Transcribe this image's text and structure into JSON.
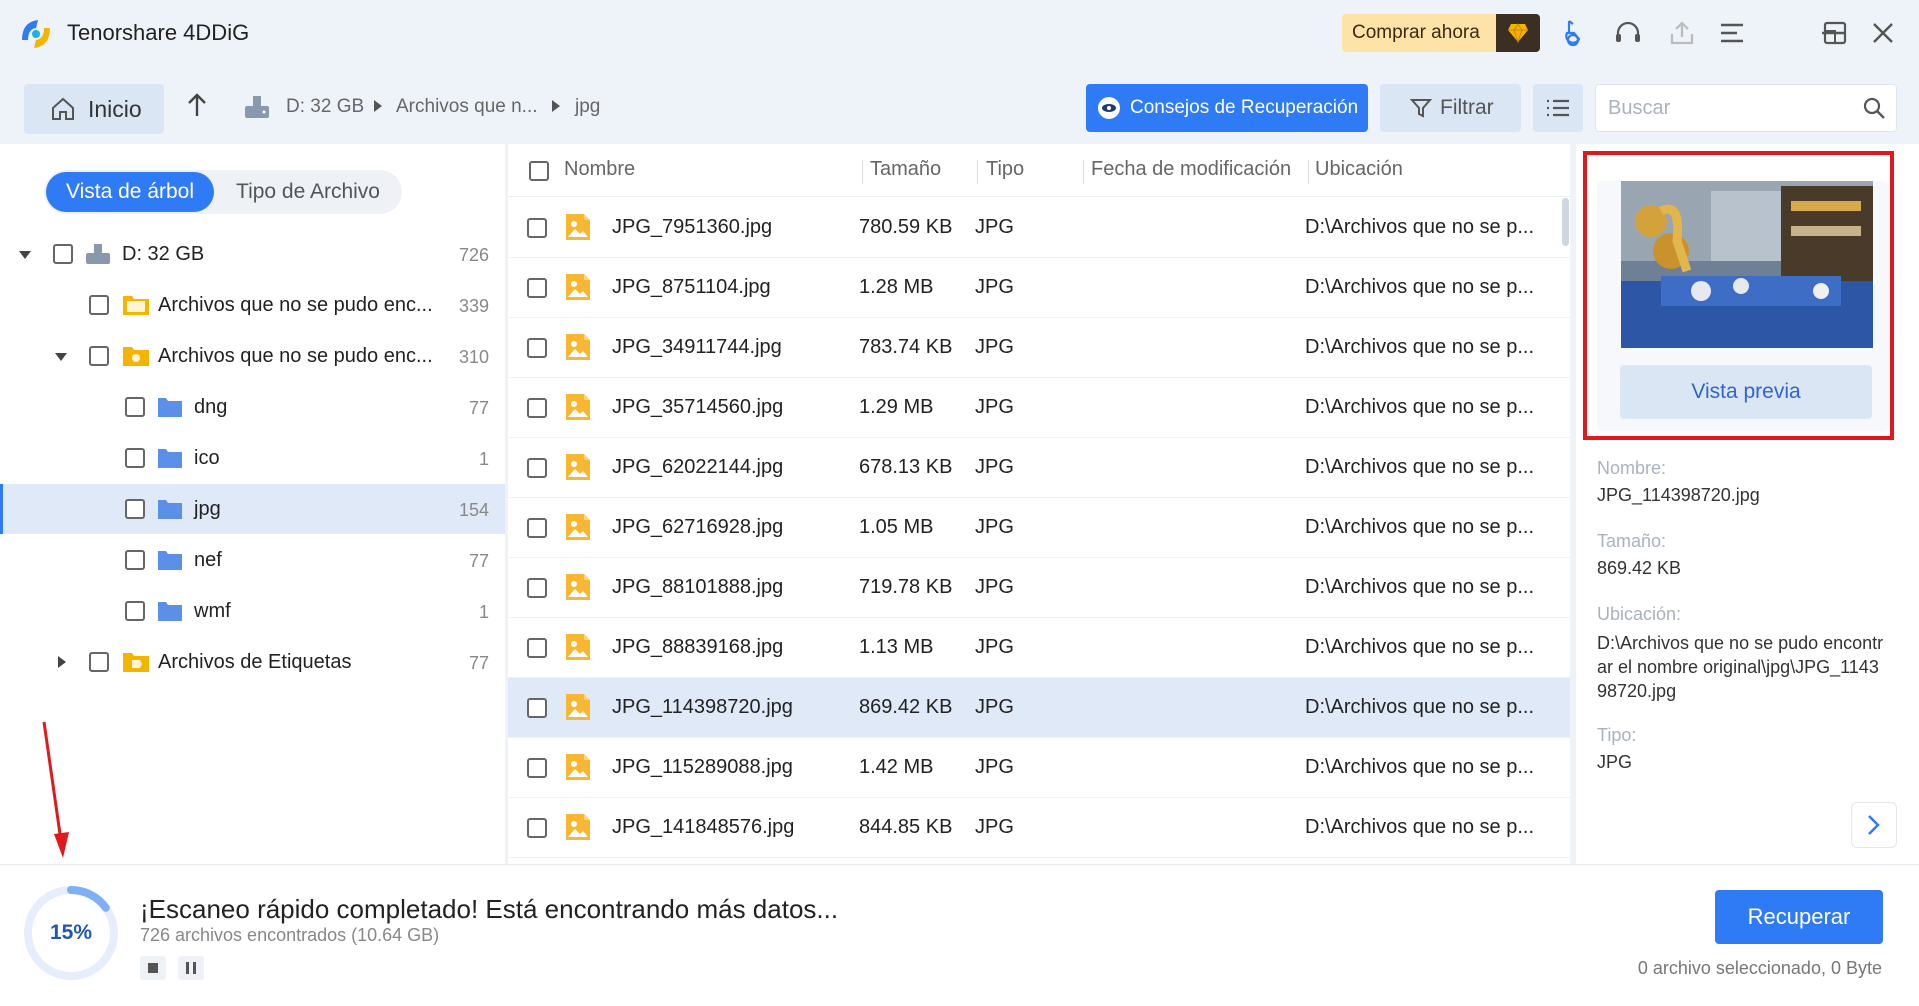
{
  "app": {
    "title": "Tenorshare 4DDiG",
    "buy_label": "Comprar ahora"
  },
  "nav": {
    "home_label": "Inicio",
    "breadcrumb": [
      "D: 32 GB",
      "Archivos que n...",
      "jpg"
    ],
    "tips_label": "Consejos de Recuperación",
    "filter_label": "Filtrar",
    "search_placeholder": "Buscar"
  },
  "tabs": {
    "tree_view": "Vista de árbol",
    "file_type": "Tipo de Archivo"
  },
  "tree": [
    {
      "label": "D: 32 GB",
      "count": "726"
    },
    {
      "label": "Archivos que no se pudo enc...",
      "count": "339"
    },
    {
      "label": "Archivos que no se pudo enc...",
      "count": "310"
    },
    {
      "label": "dng",
      "count": "77"
    },
    {
      "label": "ico",
      "count": "1"
    },
    {
      "label": "jpg",
      "count": "154"
    },
    {
      "label": "nef",
      "count": "77"
    },
    {
      "label": "wmf",
      "count": "1"
    },
    {
      "label": "Archivos de Etiquetas",
      "count": "77"
    }
  ],
  "table": {
    "headers": [
      "Nombre",
      "Tamaño",
      "Tipo",
      "Fecha de modificación",
      "Ubicación"
    ],
    "rows": [
      {
        "name": "JPG_7951360.jpg",
        "size": "780.59 KB",
        "type": "JPG",
        "location": "D:\\Archivos que no se p..."
      },
      {
        "name": "JPG_8751104.jpg",
        "size": "1.28 MB",
        "type": "JPG",
        "location": "D:\\Archivos que no se p..."
      },
      {
        "name": "JPG_34911744.jpg",
        "size": "783.74 KB",
        "type": "JPG",
        "location": "D:\\Archivos que no se p..."
      },
      {
        "name": "JPG_35714560.jpg",
        "size": "1.29 MB",
        "type": "JPG",
        "location": "D:\\Archivos que no se p..."
      },
      {
        "name": "JPG_62022144.jpg",
        "size": "678.13 KB",
        "type": "JPG",
        "location": "D:\\Archivos que no se p..."
      },
      {
        "name": "JPG_62716928.jpg",
        "size": "1.05 MB",
        "type": "JPG",
        "location": "D:\\Archivos que no se p..."
      },
      {
        "name": "JPG_88101888.jpg",
        "size": "719.78 KB",
        "type": "JPG",
        "location": "D:\\Archivos que no se p..."
      },
      {
        "name": "JPG_88839168.jpg",
        "size": "1.13 MB",
        "type": "JPG",
        "location": "D:\\Archivos que no se p..."
      },
      {
        "name": "JPG_114398720.jpg",
        "size": "869.42 KB",
        "type": "JPG",
        "location": "D:\\Archivos que no se p..."
      },
      {
        "name": "JPG_115289088.jpg",
        "size": "1.42 MB",
        "type": "JPG",
        "location": "D:\\Archivos que no se p..."
      },
      {
        "name": "JPG_141848576.jpg",
        "size": "844.85 KB",
        "type": "JPG",
        "location": "D:\\Archivos que no se p..."
      }
    ]
  },
  "preview": {
    "button_label": "Vista previa",
    "name_label": "Nombre:",
    "name_value": "JPG_114398720.jpg",
    "size_label": "Tamaño:",
    "size_value": "869.42 KB",
    "location_label": "Ubicación:",
    "location_value": "D:\\Archivos que no se pudo encontrar el nombre original\\jpg\\JPG_114398720.jpg",
    "type_label": "Tipo:",
    "type_value": "JPG"
  },
  "status": {
    "progress_percent": "15%",
    "progress_fraction": 0.15,
    "title": "¡Escaneo rápido completado! Está encontrando más datos...",
    "subtitle": "726 archivos encontrados (10.64 GB)",
    "recover_label": "Recuperar",
    "selection_info": "0 archivo seleccionado, 0 Byte"
  },
  "colors": {
    "accent": "#2f7af5",
    "highlight_border": "#e0191c",
    "selected_row": "#dfe9f8"
  }
}
